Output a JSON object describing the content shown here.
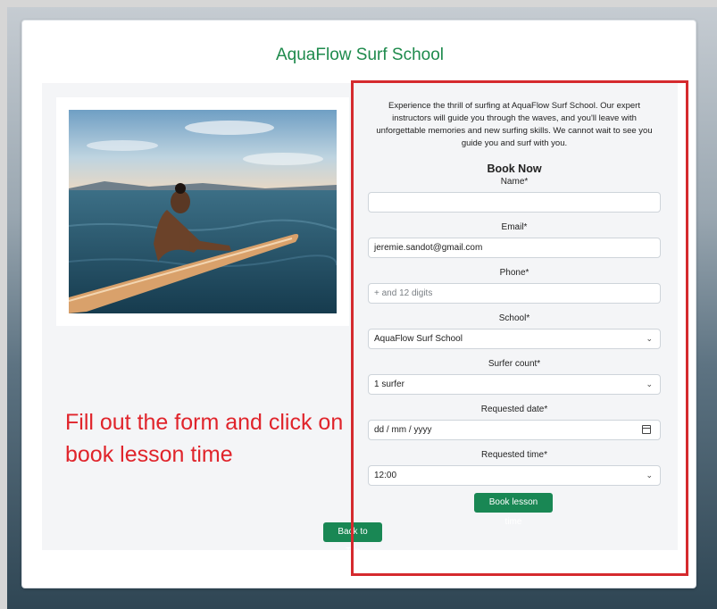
{
  "header": {
    "title": "AquaFlow Surf School"
  },
  "intro": {
    "text": "Experience the thrill of surfing at AquaFlow Surf School. Our expert instructors will guide you through the waves, and you'll leave with unforgettable memories and new surfing skills. We cannot wait to see you guide you and surf with you."
  },
  "form": {
    "title": "Book Now",
    "name_label": "Name*",
    "name_value": "",
    "email_label": "Email*",
    "email_value": "jeremie.sandot@gmail.com",
    "phone_label": "Phone*",
    "phone_placeholder": "+ and 12 digits",
    "school_label": "School*",
    "school_value": "AquaFlow Surf School",
    "surfer_label": "Surfer count*",
    "surfer_value": "1 surfer",
    "date_label": "Requested date*",
    "date_placeholder": "dd / mm / yyyy",
    "time_label": "Requested time*",
    "time_value": "12:00",
    "submit_label": "Book lesson time"
  },
  "footer": {
    "back_to_top": "Back to Top"
  },
  "annotation": {
    "text": "Fill out the form and click on book lesson time"
  },
  "colors": {
    "brand_green": "#198754",
    "title_green": "#1e8a4c",
    "annotation_red": "#e0242b"
  }
}
